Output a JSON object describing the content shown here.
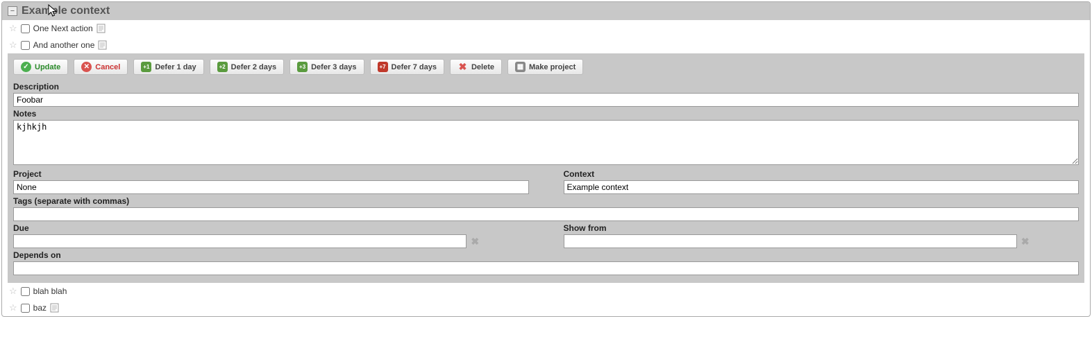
{
  "panel": {
    "title": "Example context"
  },
  "todos_above": [
    {
      "text": "One Next action",
      "has_note": true
    },
    {
      "text": "And another one",
      "has_note": true
    }
  ],
  "todos_below": [
    {
      "text": "blah blah",
      "has_note": false
    },
    {
      "text": "baz",
      "has_note": true
    }
  ],
  "toolbar": {
    "update": "Update",
    "cancel": "Cancel",
    "defer1": "Defer 1 day",
    "defer2": "Defer 2 days",
    "defer3": "Defer 3 days",
    "defer7": "Defer 7 days",
    "delete": "Delete",
    "make_project": "Make project"
  },
  "form": {
    "description_label": "Description",
    "description_value": "Foobar",
    "notes_label": "Notes",
    "notes_value": "kjhkjh",
    "project_label": "Project",
    "project_value": "None",
    "context_label": "Context",
    "context_value": "Example context",
    "tags_label": "Tags (separate with commas)",
    "tags_value": "",
    "due_label": "Due",
    "due_value": "",
    "showfrom_label": "Show from",
    "showfrom_value": "",
    "depends_label": "Depends on",
    "depends_value": ""
  }
}
